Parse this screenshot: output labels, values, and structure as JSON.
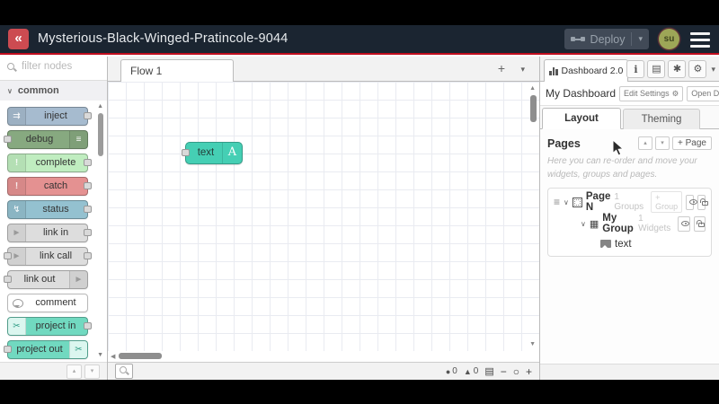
{
  "header": {
    "title": "Mysterious-Black-Winged-Pratincole-9044",
    "deploy_label": "Deploy",
    "avatar_text": "su"
  },
  "palette": {
    "filter_placeholder": "filter nodes",
    "category": "common",
    "nodes": [
      {
        "label": "inject",
        "color": "#a6bbcf"
      },
      {
        "label": "debug",
        "color": "#87a980"
      },
      {
        "label": "complete",
        "color": "#c0edc0"
      },
      {
        "label": "catch",
        "color": "#e49191"
      },
      {
        "label": "status",
        "color": "#94c1d0"
      },
      {
        "label": "link in",
        "color": "#dddddd"
      },
      {
        "label": "link call",
        "color": "#dddddd"
      },
      {
        "label": "link out",
        "color": "#dddddd"
      },
      {
        "label": "comment",
        "color": "#ffffff"
      },
      {
        "label": "project in",
        "color": "#71d9c0"
      },
      {
        "label": "project out",
        "color": "#71d9c0"
      }
    ]
  },
  "canvas": {
    "tab": "Flow 1",
    "node": {
      "label": "text",
      "icon_letter": "A",
      "color": "#45cfb4"
    }
  },
  "sidebar": {
    "tab_label": "Dashboard 2.0",
    "toolbar": {
      "title": "My Dashboard",
      "edit_settings": "Edit Settings",
      "open_dashboard": "Open Dashboard"
    },
    "tabs": {
      "layout": "Layout",
      "theming": "Theming"
    },
    "pages": {
      "heading": "Pages",
      "add_page": "+ Page",
      "help": "Here you can re-order and move your widgets, groups and pages."
    },
    "tree": {
      "page": {
        "name": "Page N",
        "badge": "1 Groups",
        "add_group": "+ Group"
      },
      "group": {
        "name": "My Group",
        "badge": "1 Widgets"
      },
      "widget": {
        "name": "text"
      }
    }
  },
  "footer": {
    "error_count": "0",
    "warning_count": "0"
  },
  "icons": {
    "logo": "«",
    "inject": "⇉",
    "debug": "≡",
    "complete": "!",
    "catch": "!",
    "status": "↯",
    "link": "►",
    "project": "✂",
    "chevron_down": "∨",
    "caret_down": "▾",
    "plus": "+",
    "scroll_up": "▲",
    "scroll_down": "▼",
    "scroll_left": "◀",
    "collapse_up": "▴",
    "collapse_down": "▾",
    "info": "i",
    "book": "▤",
    "bug": "✱",
    "gear": "⚙",
    "external": "↗",
    "drag": "≡",
    "group_grid": "▦",
    "error": "●",
    "warning": "▲",
    "map": "▤",
    "zoom_out": "−",
    "zoom_reset": "○",
    "zoom_in": "+"
  },
  "colors": {
    "header_bg": "#1b2531",
    "accent_red": "#c00d1e",
    "logo_red": "#cc4b51",
    "deploy_bg": "#414a57",
    "avatar_bg": "#9da657",
    "canvas_node": "#45cfb4"
  }
}
